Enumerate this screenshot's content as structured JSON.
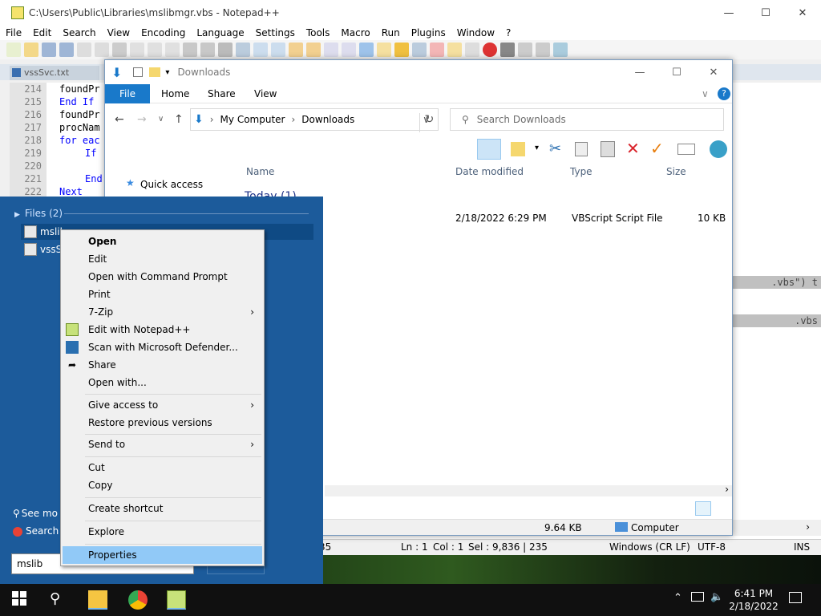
{
  "notepad": {
    "title": "C:\\Users\\Public\\Libraries\\mslibmgr.vbs - Notepad++",
    "menu": [
      "File",
      "Edit",
      "Search",
      "View",
      "Encoding",
      "Language",
      "Settings",
      "Tools",
      "Macro",
      "Run",
      "Plugins",
      "Window",
      "?"
    ],
    "tab": "vssSvc.txt",
    "lines": [
      {
        "n": "214",
        "code": "foundPr"
      },
      {
        "n": "215",
        "code": "End If"
      },
      {
        "n": "216",
        "code": "foundPr"
      },
      {
        "n": "217",
        "code": "procNam"
      },
      {
        "n": "218",
        "code": "for eac"
      },
      {
        "n": "219",
        "code": "If"
      },
      {
        "n": "220",
        "code": ""
      },
      {
        "n": "221",
        "code": "End"
      },
      {
        "n": "222",
        "code": "Next"
      }
    ],
    "code_frag1": ".vbs\") t",
    "code_frag2": ".vbs",
    "status": {
      "col_left": "35",
      "ln": "Ln : 1",
      "col": "Col : 1",
      "sel": "Sel : 9,836 | 235",
      "eol": "Windows (CR LF)",
      "enc": "UTF-8",
      "ins": "INS"
    }
  },
  "explorer": {
    "title": "Downloads",
    "ribbon_tabs": [
      "File",
      "Home",
      "Share",
      "View"
    ],
    "breadcrumb": [
      "My Computer",
      "Downloads"
    ],
    "search_placeholder": "Search Downloads",
    "nav_quick_access": "Quick access",
    "columns": {
      "name": "Name",
      "date": "Date modified",
      "type": "Type",
      "size": "Size"
    },
    "group": "Today (1)",
    "file_row": {
      "date": "2/18/2022 6:29 PM",
      "type": "VBScript Script File",
      "size": "10 KB"
    },
    "status_size": "9.64 KB",
    "status_location": "Computer"
  },
  "start": {
    "files_header": "Files (2)",
    "results": [
      "mslib",
      "vssSv"
    ],
    "see_more": "See mo",
    "search_web": "Search t",
    "query": "mslib"
  },
  "context_menu": {
    "items": [
      {
        "label": "Open",
        "bold": true
      },
      {
        "label": "Edit"
      },
      {
        "label": "Open with Command Prompt"
      },
      {
        "label": "Print"
      },
      {
        "label": "7-Zip",
        "submenu": true
      },
      {
        "label": "Edit with Notepad++"
      },
      {
        "label": "Scan with Microsoft Defender..."
      },
      {
        "label": "Share"
      },
      {
        "label": "Open with..."
      },
      {
        "label": "Give access to",
        "submenu": true
      },
      {
        "label": "Restore previous versions"
      },
      {
        "label": "Send to",
        "submenu": true
      },
      {
        "label": "Cut"
      },
      {
        "label": "Copy"
      },
      {
        "label": "Create shortcut"
      },
      {
        "label": "Explore"
      },
      {
        "label": "Properties"
      }
    ],
    "highlighted": "Properties"
  },
  "taskbar": {
    "time": "6:41 PM",
    "date": "2/18/2022",
    "apps": [
      "windows-start-icon",
      "search-icon",
      "file-explorer-icon",
      "chrome-icon",
      "notepadpp-icon"
    ]
  }
}
